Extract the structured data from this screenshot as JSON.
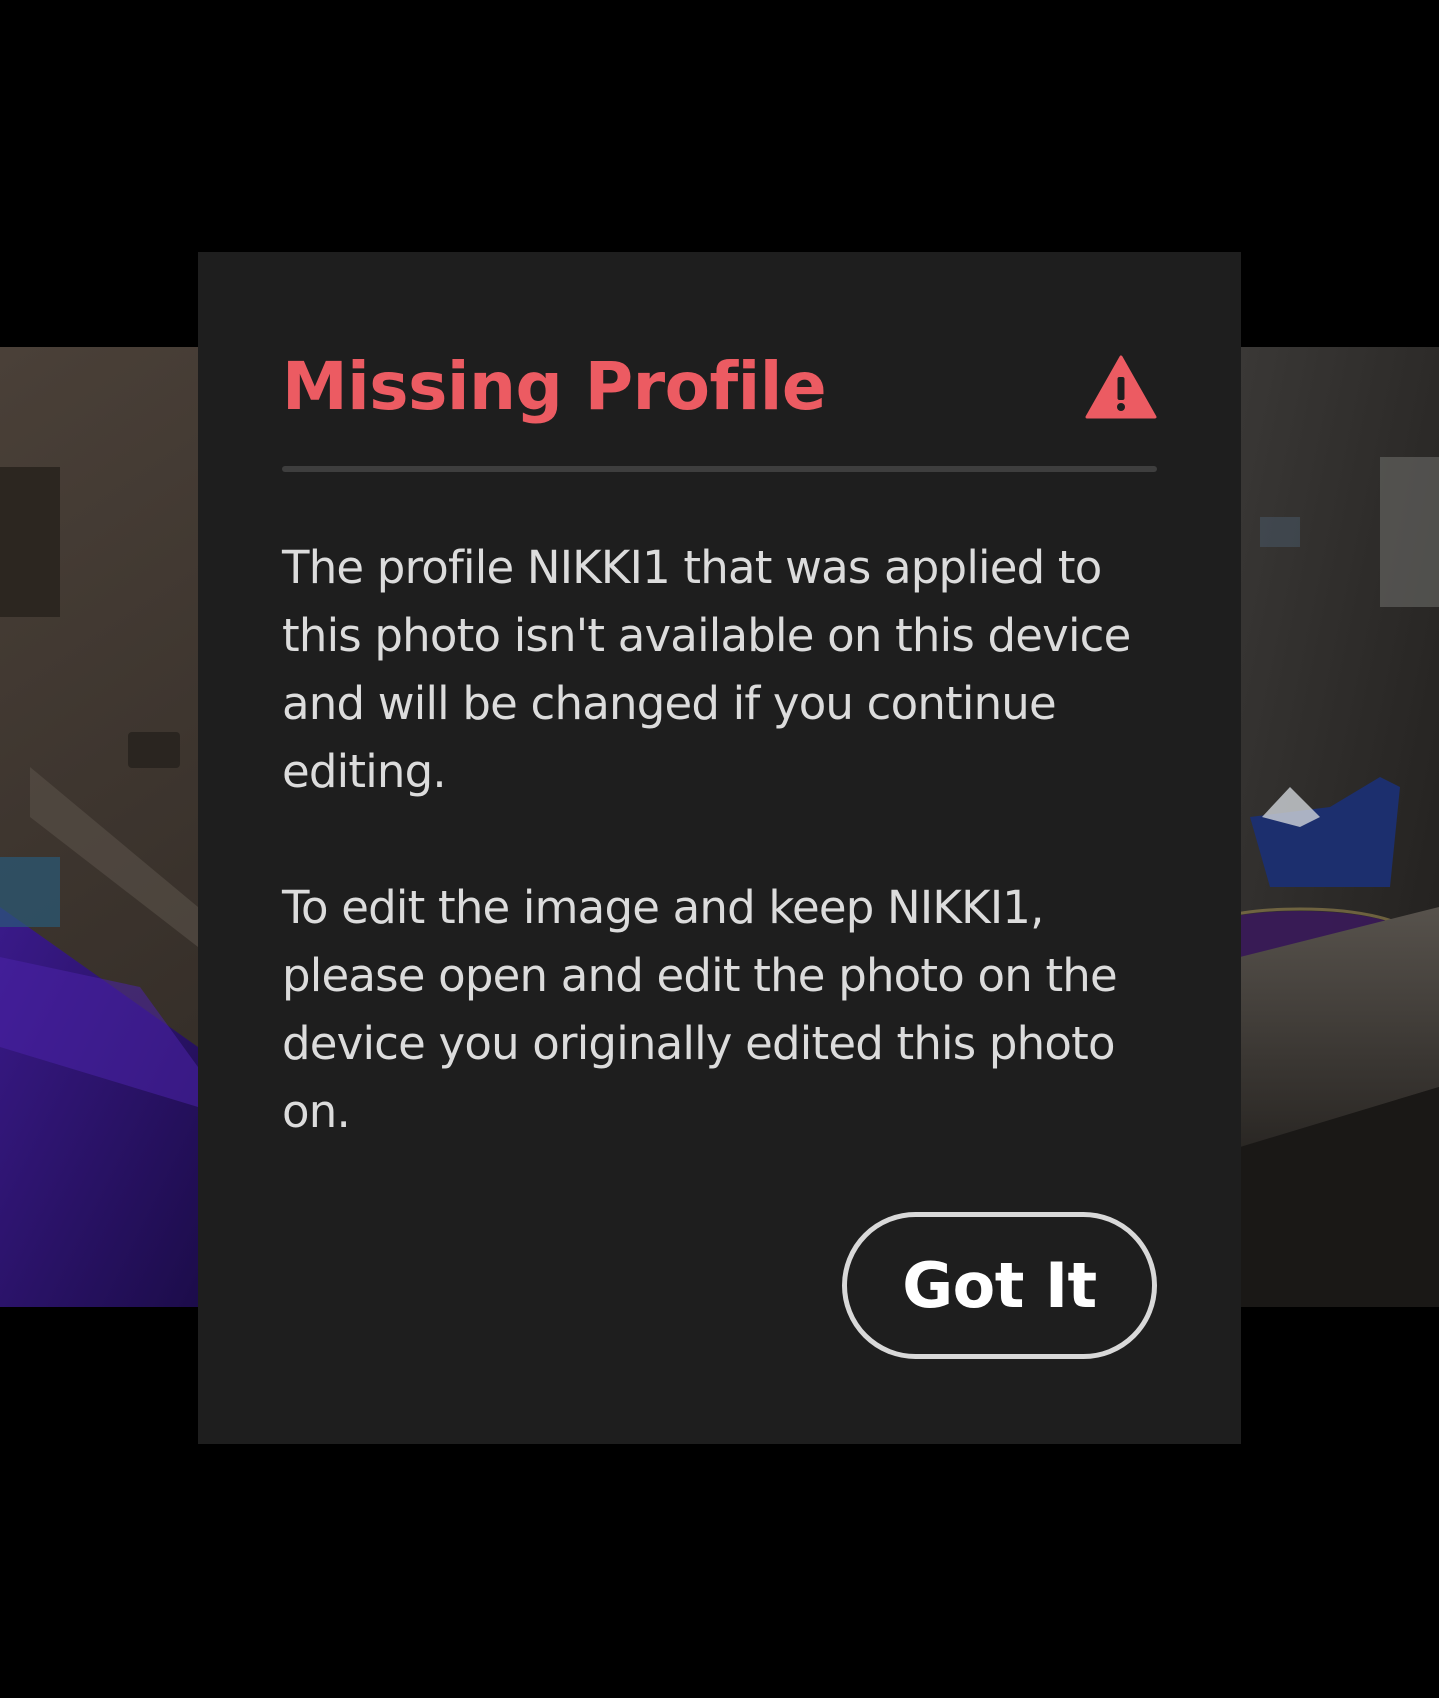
{
  "dialog": {
    "title": "Missing Profile",
    "icon": "warning-triangle-icon",
    "accent_color": "#ec5b62",
    "paragraphs": [
      "The profile NIKKI1 that was applied to this photo isn't available on this device and will be changed if you continue editing.",
      "To edit the image and keep NIKKI1, please open and edit the photo on the device you originally edited this photo on."
    ],
    "confirm_label": "Got It"
  }
}
